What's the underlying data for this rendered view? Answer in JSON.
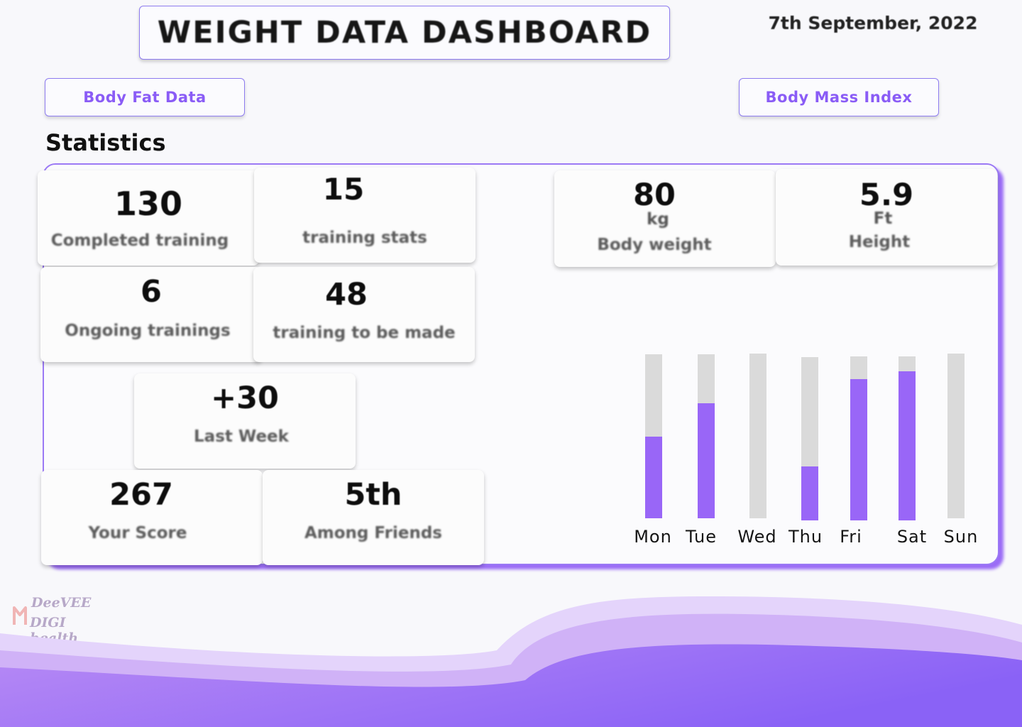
{
  "header": {
    "title": "WEIGHT DATA DASHBOARD",
    "date": "7th September, 2022"
  },
  "nav": {
    "body_fat_label": "Body Fat Data",
    "bmi_label": "Body Mass Index"
  },
  "statistics": {
    "heading": "Statistics",
    "cards": [
      {
        "value": "130",
        "label": "Completed training"
      },
      {
        "value": "15",
        "label": "training stats"
      },
      {
        "value": "6",
        "label": "Ongoing trainings"
      },
      {
        "value": "48",
        "label": "training to be made"
      },
      {
        "value": "+30",
        "label": "Last Week"
      },
      {
        "value": "267",
        "label": "Your Score"
      },
      {
        "value": "5th",
        "label": "Among Friends"
      }
    ],
    "body": {
      "weight_value": "80",
      "weight_unit": "kg",
      "weight_label": "Body weight",
      "height_value": "5.9",
      "height_unit": "Ft",
      "height_label": "Height"
    }
  },
  "chart_data": {
    "type": "bar",
    "categories": [
      "Mon",
      "Tue",
      "Wed",
      "Thu",
      "Fri",
      "Sat",
      "Sun"
    ],
    "values": [
      0.5,
      0.7,
      0,
      0.33,
      0.86,
      0.91,
      0
    ],
    "ylim": [
      0,
      1
    ],
    "grid": false,
    "colors": {
      "fill": "#9966f7",
      "track": "#dadada"
    }
  },
  "brand": {
    "line1": "DeeVEE",
    "line2": "DIGI health"
  },
  "colors": {
    "accent": "#8a5cf6",
    "border": "#8e7cf0",
    "wave_light": "#dcc9f8",
    "wave_dark": "#8b5cf6"
  }
}
